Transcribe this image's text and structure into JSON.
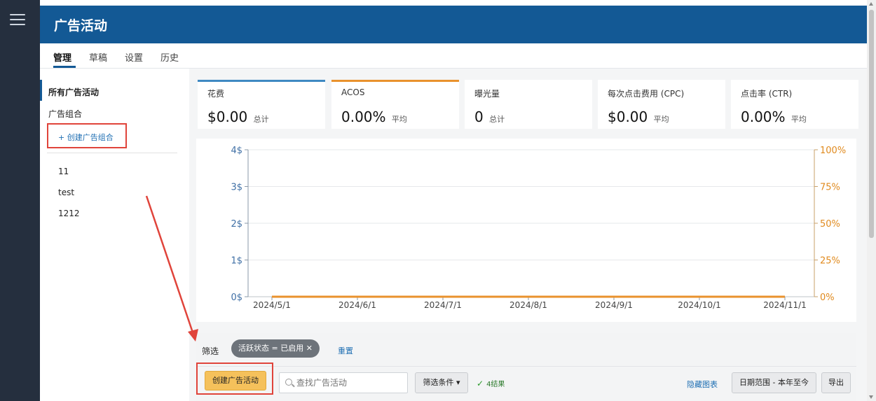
{
  "app": {
    "title": "广告活动"
  },
  "tabs": [
    {
      "label": "管理",
      "active": true
    },
    {
      "label": "草稿",
      "active": false
    },
    {
      "label": "设置",
      "active": false
    },
    {
      "label": "历史",
      "active": false
    }
  ],
  "sidebar": {
    "all_campaigns": "所有广告活动",
    "portfolios": "广告组合",
    "create_portfolio": "+ 创建广告组合",
    "items": [
      "11",
      "test",
      "1212"
    ]
  },
  "metrics": [
    {
      "label": "花费",
      "value": "$0.00",
      "sub": "总计",
      "accent": "#3f89c2"
    },
    {
      "label": "ACOS",
      "value": "0.00%",
      "sub": "平均",
      "accent": "#e9922d"
    },
    {
      "label": "曝光量",
      "value": "0",
      "sub": "总计",
      "accent": ""
    },
    {
      "label": "每次点击费用 (CPC)",
      "value": "$0.00",
      "sub": "平均",
      "accent": ""
    },
    {
      "label": "点击率 (CTR)",
      "value": "0.00%",
      "sub": "平均",
      "accent": ""
    }
  ],
  "chart_data": {
    "type": "line",
    "x": [
      "2024/5/1",
      "2024/6/1",
      "2024/7/1",
      "2024/8/1",
      "2024/9/1",
      "2024/10/1",
      "2024/11/1"
    ],
    "left_axis": {
      "ticks": [
        "0$",
        "1$",
        "2$",
        "3$",
        "4$"
      ],
      "range": [
        0,
        4
      ],
      "color": "#3f6fa5"
    },
    "right_axis": {
      "ticks": [
        "0%",
        "25%",
        "50%",
        "75%",
        "100%"
      ],
      "range": [
        0,
        100
      ],
      "color": "#e08a1e"
    },
    "series": [
      {
        "axis": "left",
        "values": [
          0,
          0,
          0,
          0,
          0,
          0,
          0
        ],
        "color": "#3f89c2"
      },
      {
        "axis": "right",
        "values": [
          0,
          0,
          0,
          0,
          0,
          0,
          0
        ],
        "color": "#e9922d"
      }
    ],
    "grid": true
  },
  "filter": {
    "label": "筛选",
    "pill": "活跃状态 = 已启用 ✕",
    "reset": "重置"
  },
  "toolbar": {
    "create_campaign": "创建广告活动",
    "search_placeholder": "查找广告活动",
    "filter_conditions": "筛选条件 ▾",
    "results": "4结果",
    "hide_chart": "隐藏图表",
    "date_range": "日期范围 - 本年至今",
    "export": "导出"
  },
  "colors": {
    "header": "#135995",
    "sidebar": "#252f3e",
    "annotation": "#e0443b"
  }
}
